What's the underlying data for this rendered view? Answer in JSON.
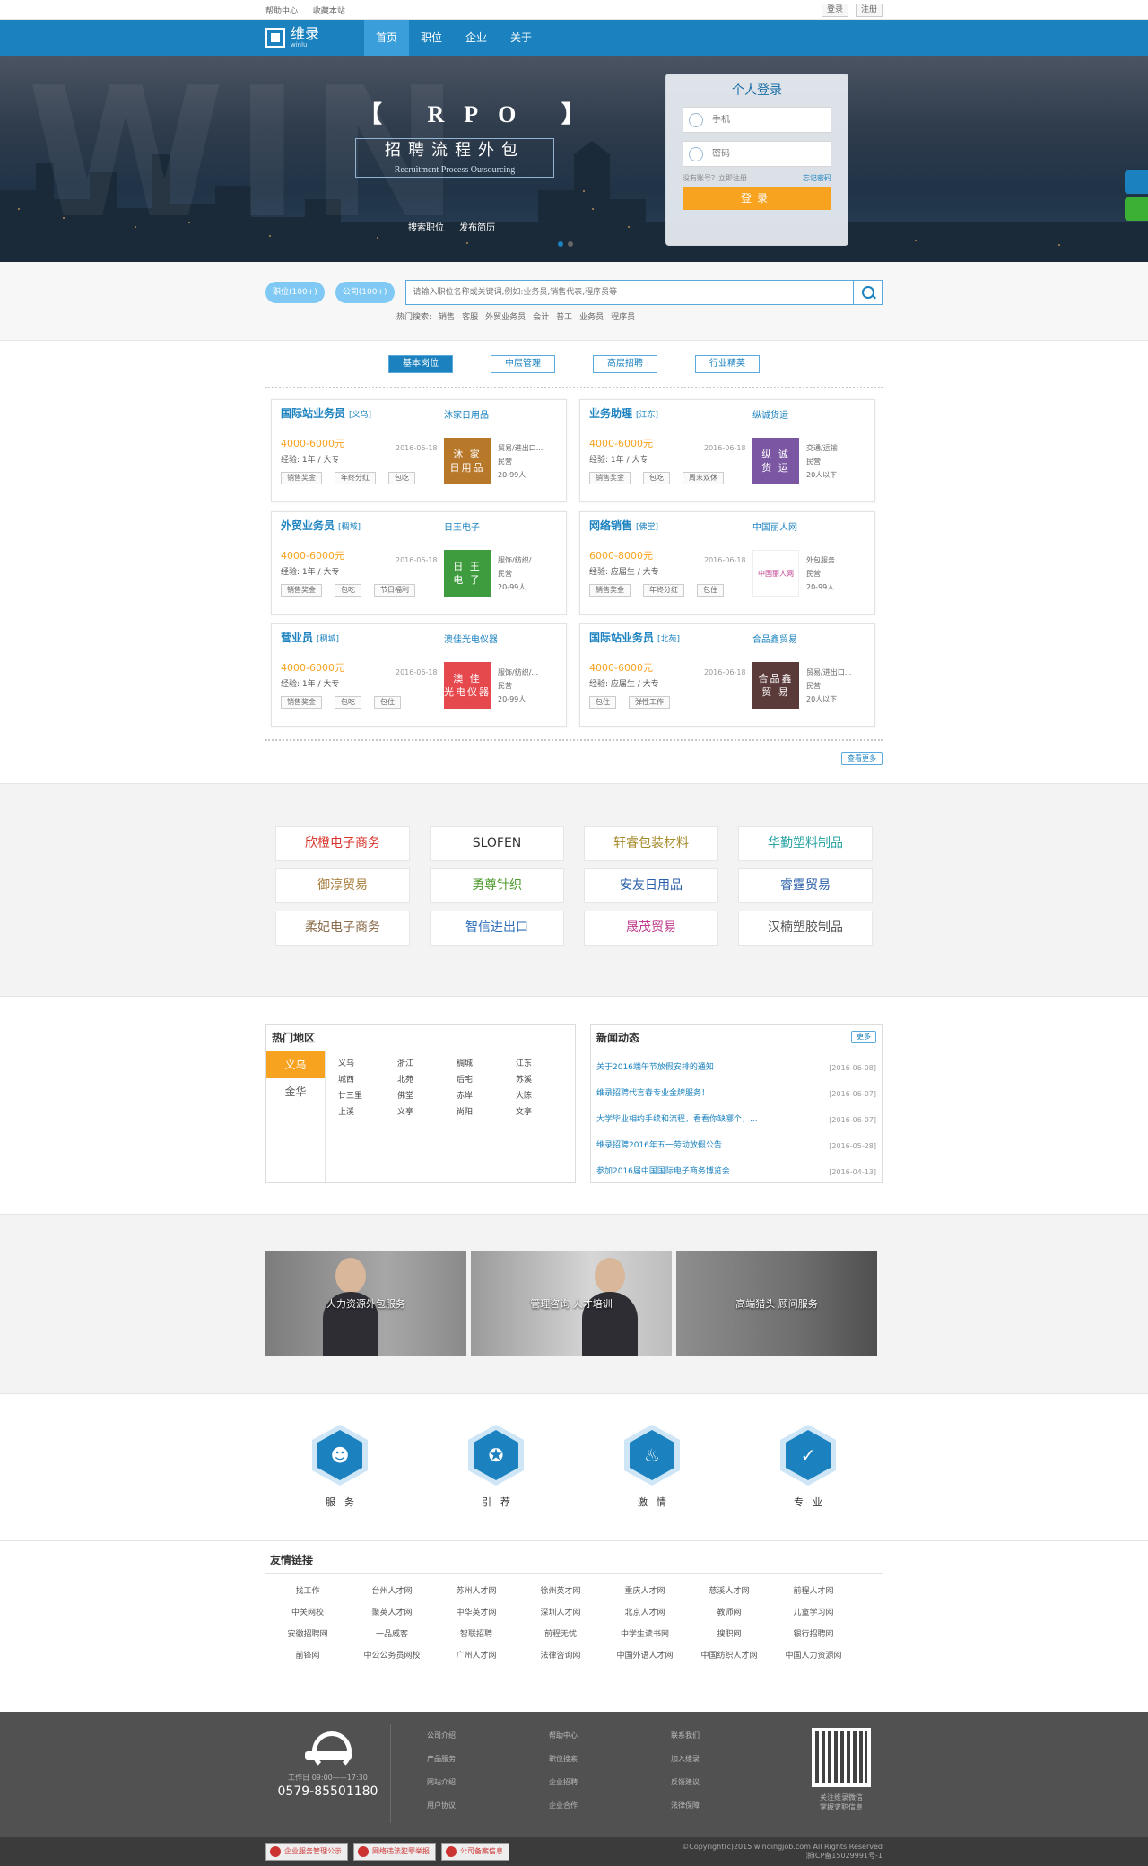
{
  "topbar": {
    "help": "帮助中心",
    "fav": "收藏本站",
    "login": "登录",
    "register": "注册"
  },
  "nav": {
    "logo": "维录",
    "logo_sub": "winlu",
    "items": [
      "首页",
      "职位",
      "企业",
      "关于"
    ]
  },
  "banner": {
    "title": "【 RPO 】",
    "subtitle": "招聘流程外包",
    "subtitle_en": "Recruitment Process Outsourcing",
    "links": [
      "搜索职位",
      "发布简历"
    ]
  },
  "login": {
    "title": "个人登录",
    "phone_placeholder": "手机",
    "pwd_placeholder": "密码",
    "no_account": "没有账号？立即注册",
    "forgot": "忘记密码",
    "submit": "登录"
  },
  "search": {
    "pill_jobs": "职位(100+)",
    "pill_companies": "公司(100+)",
    "placeholder": "请输入职位名称或关键词,例如:业务员,销售代表,程序员等",
    "hot_label": "热门搜索:",
    "hot": [
      "销售",
      "客服",
      "外贸业务员",
      "会计",
      "普工",
      "业务员",
      "程序员"
    ]
  },
  "tabs": [
    "基本岗位",
    "中层管理",
    "高层招聘",
    "行业精英"
  ],
  "jobs": [
    {
      "title": "国际站业务员",
      "loc": "[义乌]",
      "company": "沐家日用品",
      "salary": "4000-6000元",
      "date": "2016-06-18",
      "req": "经验: 1年 / 大专",
      "tags": [
        "销售奖金",
        "年终分红",
        "包吃"
      ],
      "logo": "沐 家\n日用品",
      "logo_color": "#b8782a",
      "info": [
        "贸易/进出口...",
        "民营",
        "20-99人"
      ]
    },
    {
      "title": "业务助理",
      "loc": "[江东]",
      "company": "纵诚货运",
      "salary": "4000-6000元",
      "date": "2016-06-18",
      "req": "经验: 1年 / 大专",
      "tags": [
        "销售奖金",
        "包吃",
        "周末双休"
      ],
      "logo": "纵 诚\n货 运",
      "logo_color": "#7a56a3",
      "info": [
        "交通/运输",
        "民营",
        "20人以下"
      ]
    },
    {
      "title": "外贸业务员",
      "loc": "[稠城]",
      "company": "日王电子",
      "salary": "4000-6000元",
      "date": "2016-06-18",
      "req": "经验: 1年 / 大专",
      "tags": [
        "销售奖金",
        "包吃",
        "节日福利"
      ],
      "logo": "日 王\n电 子",
      "logo_color": "#3e9b3e",
      "info": [
        "服饰/纺织/...",
        "民营",
        "20-99人"
      ]
    },
    {
      "title": "网络销售",
      "loc": "[佛堂]",
      "company": "中国丽人网",
      "salary": "6000-8000元",
      "date": "2016-06-18",
      "req": "经验: 应届生 / 大专",
      "tags": [
        "销售奖金",
        "年终分红",
        "包住"
      ],
      "logo": "中国丽人网",
      "logo_color": "#ffffff",
      "info": [
        "外包服务",
        "民营",
        "20-99人"
      ]
    },
    {
      "title": "营业员",
      "loc": "[稠城]",
      "company": "澳佳光电仪器",
      "salary": "4000-6000元",
      "date": "2016-06-18",
      "req": "经验: 1年 / 大专",
      "tags": [
        "销售奖金",
        "包吃",
        "包住"
      ],
      "logo": "澳 佳\n光电仪器",
      "logo_color": "#e5484d",
      "info": [
        "服饰/纺织/...",
        "民营",
        "20-99人"
      ]
    },
    {
      "title": "国际站业务员",
      "loc": "[北苑]",
      "company": "合品鑫贸易",
      "salary": "4000-6000元",
      "date": "2016-06-18",
      "req": "经验: 应届生 / 大专",
      "tags": [
        "包住",
        "弹性工作"
      ],
      "logo": "合品鑫\n贸 易",
      "logo_color": "#5b3a3a",
      "info": [
        "贸易/进出口...",
        "民营",
        "20人以下"
      ]
    }
  ],
  "more": "查看更多",
  "brands": [
    {
      "name": "欣橙电子商务",
      "color": "#d9342b"
    },
    {
      "name": "SLOFEN",
      "color": "#333333"
    },
    {
      "name": "轩睿包装材料",
      "color": "#a58a2a"
    },
    {
      "name": "华勤塑料制品",
      "color": "#2aa3a3"
    },
    {
      "name": "御淳贸易",
      "color": "#a67c3a"
    },
    {
      "name": "勇尊针织",
      "color": "#4e9b2e"
    },
    {
      "name": "安友日用品",
      "color": "#2a5ea8"
    },
    {
      "name": "睿霆贸易",
      "color": "#2a5ea8"
    },
    {
      "name": "柔妃电子商务",
      "color": "#8a6b4a"
    },
    {
      "name": "智信进出口",
      "color": "#2a6cb8"
    },
    {
      "name": "晟茂贸易",
      "color": "#c03a8c"
    },
    {
      "name": "汉楠塑胶制品",
      "color": "#555555"
    }
  ],
  "regions": {
    "title": "热门地区",
    "tabs": [
      "义乌",
      "金华"
    ],
    "cities": [
      "义乌",
      "浙江",
      "稠城",
      "江东",
      "城西",
      "北苑",
      "后宅",
      "苏溪",
      "廿三里",
      "佛堂",
      "赤岸",
      "大陈",
      "上溪",
      "义亭",
      "尚阳",
      "文亭"
    ]
  },
  "news": {
    "title": "新闻动态",
    "more": "更多",
    "items": [
      {
        "t": "关于2016端午节放假安排的通知",
        "d": "[2016-06-08]"
      },
      {
        "t": "维录招聘代言春专业金牌服务！",
        "d": "[2016-06-07]"
      },
      {
        "t": "大学毕业相约手续和流程，看看你缺哪个，...",
        "d": "[2016-06-07]"
      },
      {
        "t": "维录招聘2016年五一劳动放假公告",
        "d": "[2016-05-28]"
      },
      {
        "t": "参加2016届中国国际电子商务博览会",
        "d": "[2016-04-13]"
      }
    ]
  },
  "services": [
    "人力资源外包服务",
    "管理咨询 人才培训",
    "高端猎头 顾问服务"
  ],
  "features": [
    "服务",
    "引荐",
    "激情",
    "专业"
  ],
  "friend_links": {
    "title": "友情链接",
    "items": [
      "找工作",
      "台州人才网",
      "苏州人才网",
      "徐州英才网",
      "重庆人才网",
      "慈溪人才网",
      "前程人才网",
      "中关网校",
      "聚英人才网",
      "中华英才网",
      "深圳人才网",
      "北京人才网",
      "教师网",
      "儿童学习网",
      "安徽招聘网",
      "一品威客",
      "智联招聘",
      "前程无忧",
      "中学生读书网",
      "搜职网",
      "银行招聘网",
      "前锋网",
      "中公公务员网校",
      "广州人才网",
      "法律咨询网",
      "中国外语人才网",
      "中国纺织人才网",
      "中国人力资源网"
    ]
  },
  "footer": {
    "worktime": "工作日 09:00——17:30",
    "phone": "0579-85501180",
    "cols": [
      [
        "公司介绍",
        "产品服务",
        "网站介绍",
        "用户协议"
      ],
      [
        "帮助中心",
        "职位搜索",
        "企业招聘",
        "企业合作"
      ],
      [
        "联系我们",
        "加入维录",
        "反馈建议",
        "法律保障"
      ]
    ],
    "qr_text": "关注维录微信\n掌握求职信息"
  },
  "bottom": {
    "badges": [
      "企业服务管理公示",
      "网络违法犯罪举报",
      "公司备案信息"
    ],
    "copyright": "©Copyright(c)2015 windingjob.com All Rights Reserved",
    "icp": "浙ICP备15029991号-1"
  }
}
